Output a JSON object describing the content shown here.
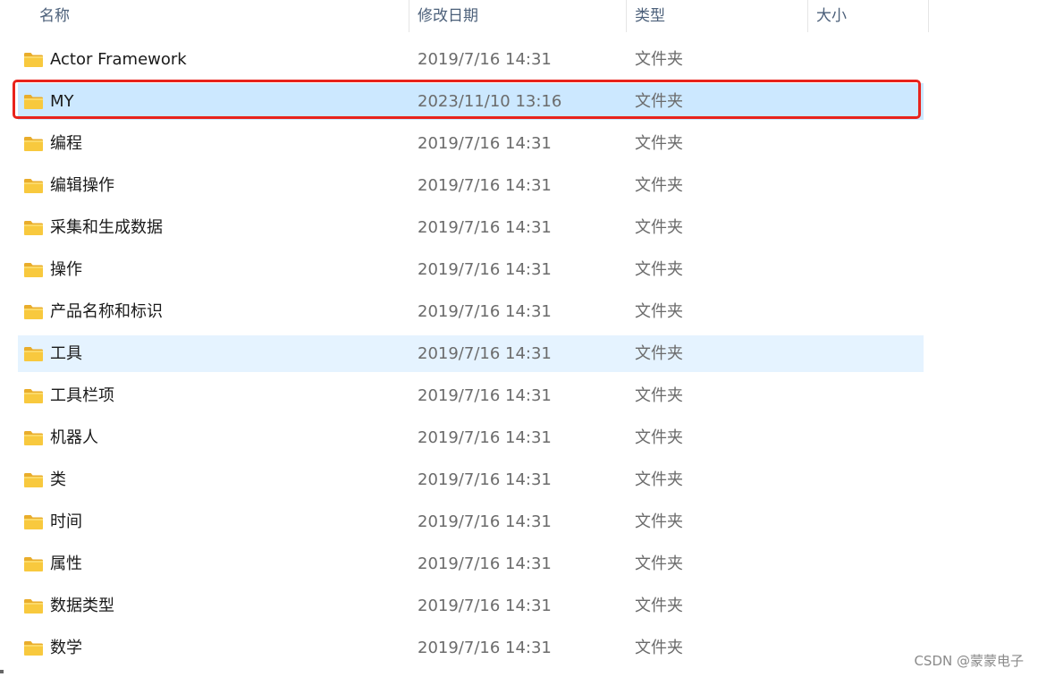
{
  "columns": {
    "name": "名称",
    "date": "修改日期",
    "type": "类型",
    "size": "大小"
  },
  "rows": [
    {
      "name": "Actor Framework",
      "date": "2019/7/16 14:31",
      "type": "文件夹",
      "state": "normal"
    },
    {
      "name": "MY",
      "date": "2023/11/10 13:16",
      "type": "文件夹",
      "state": "selected"
    },
    {
      "name": "编程",
      "date": "2019/7/16 14:31",
      "type": "文件夹",
      "state": "normal"
    },
    {
      "name": "编辑操作",
      "date": "2019/7/16 14:31",
      "type": "文件夹",
      "state": "normal"
    },
    {
      "name": "采集和生成数据",
      "date": "2019/7/16 14:31",
      "type": "文件夹",
      "state": "normal"
    },
    {
      "name": "操作",
      "date": "2019/7/16 14:31",
      "type": "文件夹",
      "state": "normal"
    },
    {
      "name": "产品名称和标识",
      "date": "2019/7/16 14:31",
      "type": "文件夹",
      "state": "normal"
    },
    {
      "name": "工具",
      "date": "2019/7/16 14:31",
      "type": "文件夹",
      "state": "hover"
    },
    {
      "name": "工具栏项",
      "date": "2019/7/16 14:31",
      "type": "文件夹",
      "state": "normal"
    },
    {
      "name": "机器人",
      "date": "2019/7/16 14:31",
      "type": "文件夹",
      "state": "normal"
    },
    {
      "name": "类",
      "date": "2019/7/16 14:31",
      "type": "文件夹",
      "state": "normal"
    },
    {
      "name": "时间",
      "date": "2019/7/16 14:31",
      "type": "文件夹",
      "state": "normal"
    },
    {
      "name": "属性",
      "date": "2019/7/16 14:31",
      "type": "文件夹",
      "state": "normal"
    },
    {
      "name": "数据类型",
      "date": "2019/7/16 14:31",
      "type": "文件夹",
      "state": "normal"
    },
    {
      "name": "数学",
      "date": "2019/7/16 14:31",
      "type": "文件夹",
      "state": "normal"
    }
  ],
  "watermark": "CSDN @蒙蒙电子",
  "colors": {
    "selected_bg": "#cce8ff",
    "hover_bg": "#e5f3ff",
    "annotation_red": "#e8231c",
    "folder_yellow": "#f8c93e"
  }
}
